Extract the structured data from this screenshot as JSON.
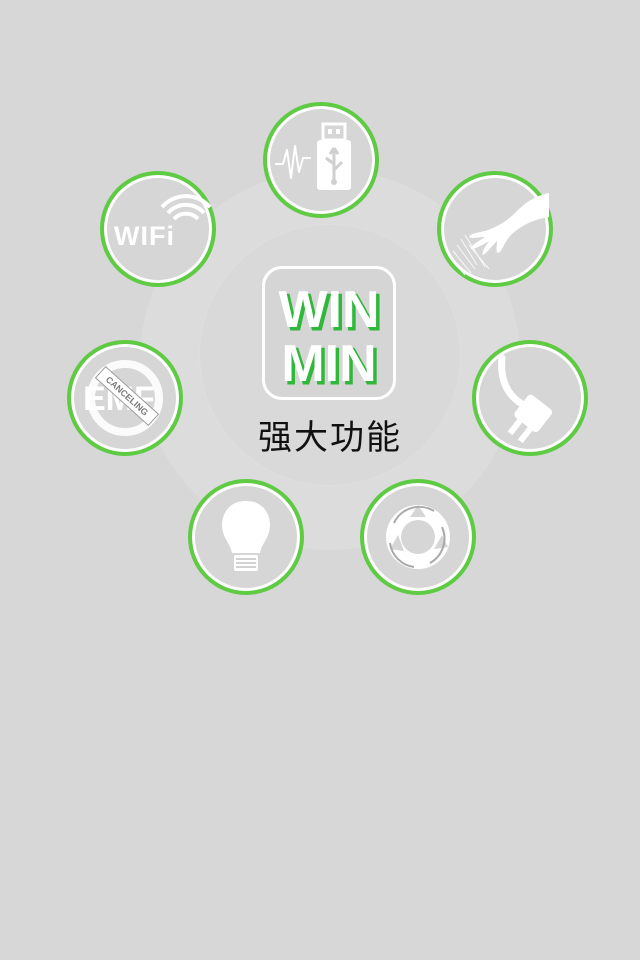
{
  "center": {
    "logo_line1": "WIN",
    "logo_line2": "MIN",
    "caption": "强大功能"
  },
  "features": {
    "usb": {
      "icon": "usb-icon"
    },
    "hand": {
      "icon": "hand-icon"
    },
    "plug": {
      "icon": "power-plug-icon"
    },
    "recycle": {
      "icon": "recycle-icon"
    },
    "bulb": {
      "icon": "light-bulb-icon"
    },
    "emf": {
      "icon": "emf-canceling-icon",
      "text": "EMF",
      "band": "CANCELING"
    },
    "wifi": {
      "icon": "wifi-icon",
      "text": "WIFi"
    }
  },
  "colors": {
    "background": "#d7d7d7",
    "accent_green": "#5ecb43",
    "icon_white": "#ffffff"
  }
}
